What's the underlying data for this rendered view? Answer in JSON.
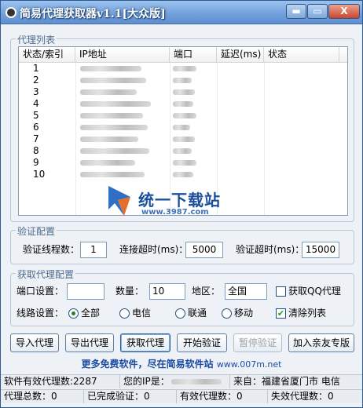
{
  "window": {
    "title": "简易代理获取器v1.1[大众版]",
    "min_label": "▬",
    "max_label": "▭",
    "close_label": "X"
  },
  "proxy_list": {
    "group_title": "代理列表",
    "columns": [
      "状态/索引",
      "IP地址",
      "端口",
      "延迟(ms)",
      "状态"
    ],
    "rows": [
      {
        "index": "1"
      },
      {
        "index": "2"
      },
      {
        "index": "3"
      },
      {
        "index": "4"
      },
      {
        "index": "5"
      },
      {
        "index": "6"
      },
      {
        "index": "7"
      },
      {
        "index": "8"
      },
      {
        "index": "9"
      },
      {
        "index": "10"
      }
    ]
  },
  "watermark": {
    "title": "统一下载站",
    "url": "www.3987.com"
  },
  "verify": {
    "group_title": "验证配置",
    "threads_label": "验证线程数：",
    "threads_value": "1",
    "conn_timeout_label": "连接超时(ms)：",
    "conn_timeout_value": "5000",
    "verify_timeout_label": "验证超时(ms)：",
    "verify_timeout_value": "15000"
  },
  "fetch": {
    "group_title": "获取代理配置",
    "port_label": "端口设置：",
    "port_value": "",
    "count_label": "数量：",
    "count_value": "10",
    "region_label": "地区：",
    "region_value": "全国",
    "qq_proxy_label": "获取QQ代理",
    "qq_proxy_checked": false,
    "line_label": "线路设置：",
    "lines": [
      {
        "label": "全部",
        "selected": true
      },
      {
        "label": "电信",
        "selected": false
      },
      {
        "label": "联通",
        "selected": false
      },
      {
        "label": "移动",
        "selected": false
      }
    ],
    "clear_list_label": "清除列表",
    "clear_list_checked": true
  },
  "buttons": {
    "import": "导入代理",
    "export": "导出代理",
    "fetch": "获取代理",
    "start_verify": "开始验证",
    "pause_verify": "暂停验证",
    "add_friend": "加入亲友专版"
  },
  "promo": {
    "text": "更多免费软件，尽在简易软件站",
    "url": "www.007m.net"
  },
  "status": {
    "valid_count": "软件有效代理数:2287",
    "your_ip": "您的IP是：",
    "from": "来自：福建省厦门市 电信",
    "total": "代理总数：0",
    "completed": "已完成验证：0",
    "valid": "有效代理数：0",
    "invalid": "失效代理数：0"
  },
  "colors": {
    "accent": "#6f9fdb",
    "link_blue": "#1b4ca3",
    "check_green": "#21a121"
  }
}
